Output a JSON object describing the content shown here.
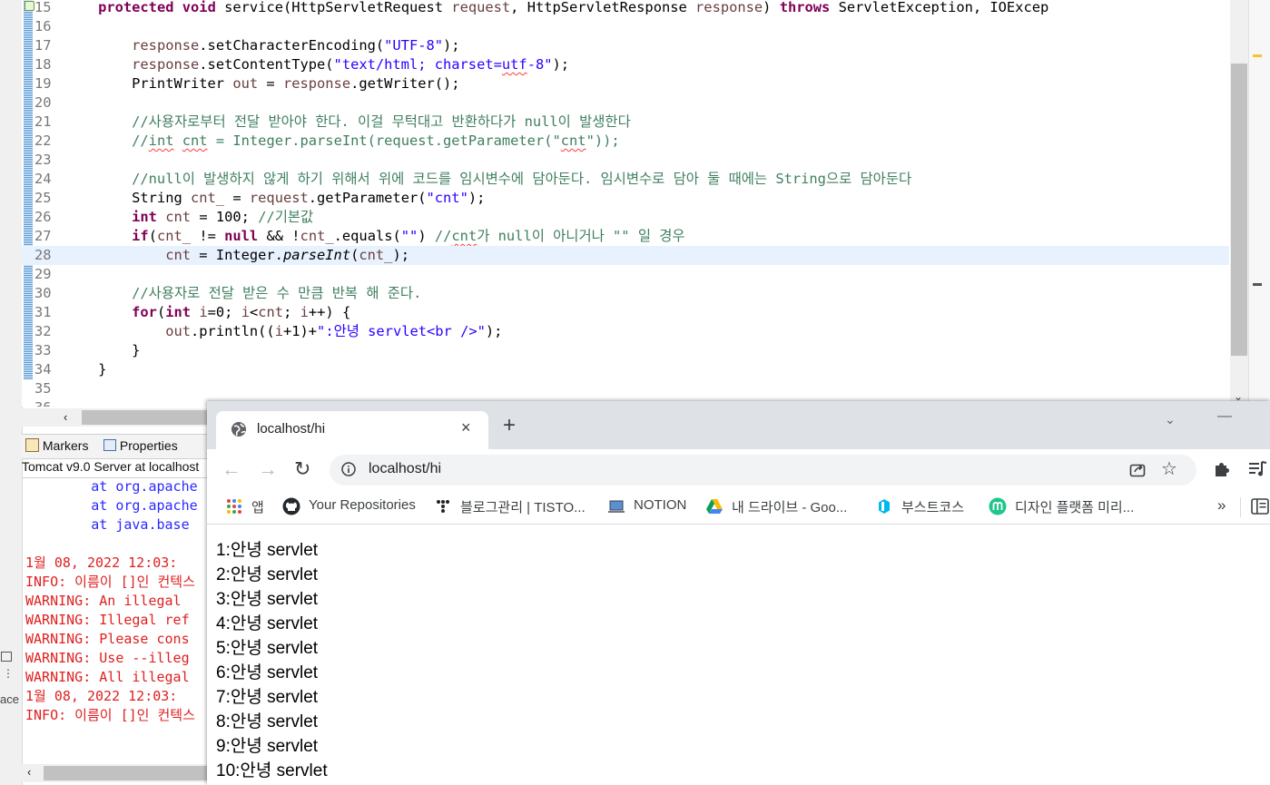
{
  "editor": {
    "lines": [
      {
        "n": "15",
        "segs": [
          [
            "",
            "    "
          ],
          [
            "kw",
            "protected"
          ],
          [
            "",
            " "
          ],
          [
            "kw",
            "void"
          ],
          [
            "",
            " service(HttpServletRequest "
          ],
          [
            "var",
            "request"
          ],
          [
            "",
            ", HttpServletResponse "
          ],
          [
            "var",
            "response"
          ],
          [
            "",
            ") "
          ],
          [
            "kw",
            "throws"
          ],
          [
            "",
            " ServletException, IOExcep"
          ]
        ]
      },
      {
        "n": "16",
        "segs": []
      },
      {
        "n": "17",
        "segs": [
          [
            "",
            "        "
          ],
          [
            "var",
            "response"
          ],
          [
            "",
            ".setCharacterEncoding("
          ],
          [
            "str",
            "\"UTF-8\""
          ],
          [
            "",
            ");"
          ]
        ]
      },
      {
        "n": "18",
        "segs": [
          [
            "",
            "        "
          ],
          [
            "var",
            "response"
          ],
          [
            "",
            ".setContentType("
          ],
          [
            "str",
            "\"text/html; charset="
          ],
          [
            "str sq",
            "utf"
          ],
          [
            "str",
            "-8\""
          ],
          [
            "",
            ");"
          ]
        ]
      },
      {
        "n": "19",
        "segs": [
          [
            "",
            "        PrintWriter "
          ],
          [
            "var",
            "out"
          ],
          [
            "",
            " = "
          ],
          [
            "var",
            "response"
          ],
          [
            "",
            ".getWriter();"
          ]
        ]
      },
      {
        "n": "20",
        "segs": []
      },
      {
        "n": "21",
        "segs": [
          [
            "cmt",
            "        //사용자로부터 전달 받아야 한다. 이걸 무턱대고 반환하다가 null이 발생한다"
          ]
        ]
      },
      {
        "n": "22",
        "segs": [
          [
            "cmt",
            "        //"
          ],
          [
            "cmt sq",
            "int"
          ],
          [
            "cmt",
            " "
          ],
          [
            "cmt sq",
            "cnt"
          ],
          [
            "cmt",
            " = Integer.parseInt(request.getParameter(\""
          ],
          [
            "cmt sq",
            "cnt"
          ],
          [
            "cmt",
            "\"));"
          ]
        ]
      },
      {
        "n": "23",
        "segs": []
      },
      {
        "n": "24",
        "segs": [
          [
            "cmt",
            "        //null이 발생하지 않게 하기 위해서 위에 코드를 임시변수에 담아둔다. 임시변수로 담아 둘 때에는 String으로 담아둔다"
          ]
        ]
      },
      {
        "n": "25",
        "segs": [
          [
            "",
            "        String "
          ],
          [
            "var",
            "cnt_"
          ],
          [
            "",
            " = "
          ],
          [
            "var",
            "request"
          ],
          [
            "",
            ".getParameter("
          ],
          [
            "str",
            "\"cnt\""
          ],
          [
            "",
            ");"
          ]
        ]
      },
      {
        "n": "26",
        "segs": [
          [
            "",
            "        "
          ],
          [
            "kw",
            "int"
          ],
          [
            "",
            " "
          ],
          [
            "var",
            "cnt"
          ],
          [
            "",
            " = 100; "
          ],
          [
            "cmt",
            "//기본값"
          ]
        ]
      },
      {
        "n": "27",
        "segs": [
          [
            "",
            "        "
          ],
          [
            "kw",
            "if"
          ],
          [
            "",
            "("
          ],
          [
            "var",
            "cnt_"
          ],
          [
            "",
            " != "
          ],
          [
            "kw",
            "null"
          ],
          [
            "",
            " && !"
          ],
          [
            "var",
            "cnt_"
          ],
          [
            "",
            ".equals("
          ],
          [
            "str",
            "\"\""
          ],
          [
            "",
            ") "
          ],
          [
            "cmt",
            "//"
          ],
          [
            "cmt sq",
            "cnt"
          ],
          [
            "cmt",
            "가 null이 아니거나 \"\" 일 경우"
          ]
        ]
      },
      {
        "n": "28",
        "segs": [
          [
            "",
            "            "
          ],
          [
            "var",
            "cnt"
          ],
          [
            "",
            " = Integer."
          ],
          [
            "it",
            "parseInt"
          ],
          [
            "",
            "("
          ],
          [
            "var",
            "cnt_"
          ],
          [
            "",
            ");"
          ]
        ]
      },
      {
        "n": "29",
        "segs": []
      },
      {
        "n": "30",
        "segs": [
          [
            "cmt",
            "        //사용자로 전달 받은 수 만큼 반복 해 준다."
          ]
        ]
      },
      {
        "n": "31",
        "segs": [
          [
            "",
            "        "
          ],
          [
            "kw",
            "for"
          ],
          [
            "",
            "("
          ],
          [
            "kw",
            "int"
          ],
          [
            "",
            " "
          ],
          [
            "var",
            "i"
          ],
          [
            "",
            "=0; "
          ],
          [
            "var",
            "i"
          ],
          [
            "",
            "<"
          ],
          [
            "var",
            "cnt"
          ],
          [
            "",
            "; "
          ],
          [
            "var",
            "i"
          ],
          [
            "",
            "++) {"
          ]
        ]
      },
      {
        "n": "32",
        "segs": [
          [
            "",
            "            "
          ],
          [
            "var",
            "out"
          ],
          [
            "",
            ".println(("
          ],
          [
            "var",
            "i"
          ],
          [
            "",
            "+1)+"
          ],
          [
            "str",
            "\":안녕 servlet<br />\""
          ],
          [
            "",
            ");"
          ]
        ]
      },
      {
        "n": "33",
        "segs": [
          [
            "",
            "        }"
          ]
        ]
      },
      {
        "n": "34",
        "segs": [
          [
            "",
            "    }"
          ]
        ]
      },
      {
        "n": "35",
        "segs": []
      },
      {
        "n": "36",
        "segs": []
      }
    ]
  },
  "bottom_panel": {
    "tabs": [
      {
        "label": "Markers",
        "icon": "markers-icon"
      },
      {
        "label": "Properties",
        "icon": "properties-icon"
      }
    ],
    "server_title": "Tomcat v9.0 Server at localhost",
    "console_lines": [
      {
        "t": "        at org.apache",
        "c": "blue"
      },
      {
        "t": "        at org.apache",
        "c": "blue"
      },
      {
        "t": "        at java.base",
        "c": "blue"
      },
      {
        "t": "",
        "c": "red"
      },
      {
        "t": "1월 08, 2022 12:03:",
        "c": "red"
      },
      {
        "t": "INFO: 이름이 []인 컨텍스",
        "c": "red"
      },
      {
        "t": "WARNING: An illegal",
        "c": "red"
      },
      {
        "t": "WARNING: Illegal ref",
        "c": "red"
      },
      {
        "t": "WARNING: Please cons",
        "c": "red"
      },
      {
        "t": "WARNING: Use --illeg",
        "c": "red"
      },
      {
        "t": "WARNING: All illegal",
        "c": "red"
      },
      {
        "t": "1월 08, 2022 12:03:",
        "c": "red"
      },
      {
        "t": "INFO: 이름이 []인 컨텍스",
        "c": "red"
      }
    ],
    "side_label": "ace"
  },
  "browser": {
    "tab": {
      "title": "localhost/hi",
      "favicon": "globe-icon",
      "close": "×"
    },
    "new_tab_symbol": "+",
    "tab_search_symbol": "⌄",
    "minimize_symbol": "—",
    "toolbar": {
      "back_symbol": "←",
      "forward_symbol": "→",
      "reload_symbol": "↻",
      "url": "localhost/hi",
      "star_symbol": "☆"
    },
    "bookmarks": [
      {
        "label": "앱",
        "icon": "apps-grid-icon"
      },
      {
        "label": "Your Repositories",
        "icon": "github-icon"
      },
      {
        "label": "블로그관리 | TISTO...",
        "icon": "tistory-icon"
      },
      {
        "label": "NOTION",
        "icon": "laptop-icon"
      },
      {
        "label": "내 드라이브 - Goo...",
        "icon": "google-drive-icon"
      },
      {
        "label": "부스트코스",
        "icon": "boostcourse-icon"
      },
      {
        "label": "디자인 플랫폼 미리...",
        "icon": "miricanvas-icon"
      }
    ],
    "bookmarks_more": "»",
    "page_lines": [
      "1:안녕 servlet",
      "2:안녕 servlet",
      "3:안녕 servlet",
      "4:안녕 servlet",
      "5:안녕 servlet",
      "6:안녕 servlet",
      "7:안녕 servlet",
      "8:안녕 servlet",
      "9:안녕 servlet",
      "10:안녕 servlet"
    ]
  }
}
